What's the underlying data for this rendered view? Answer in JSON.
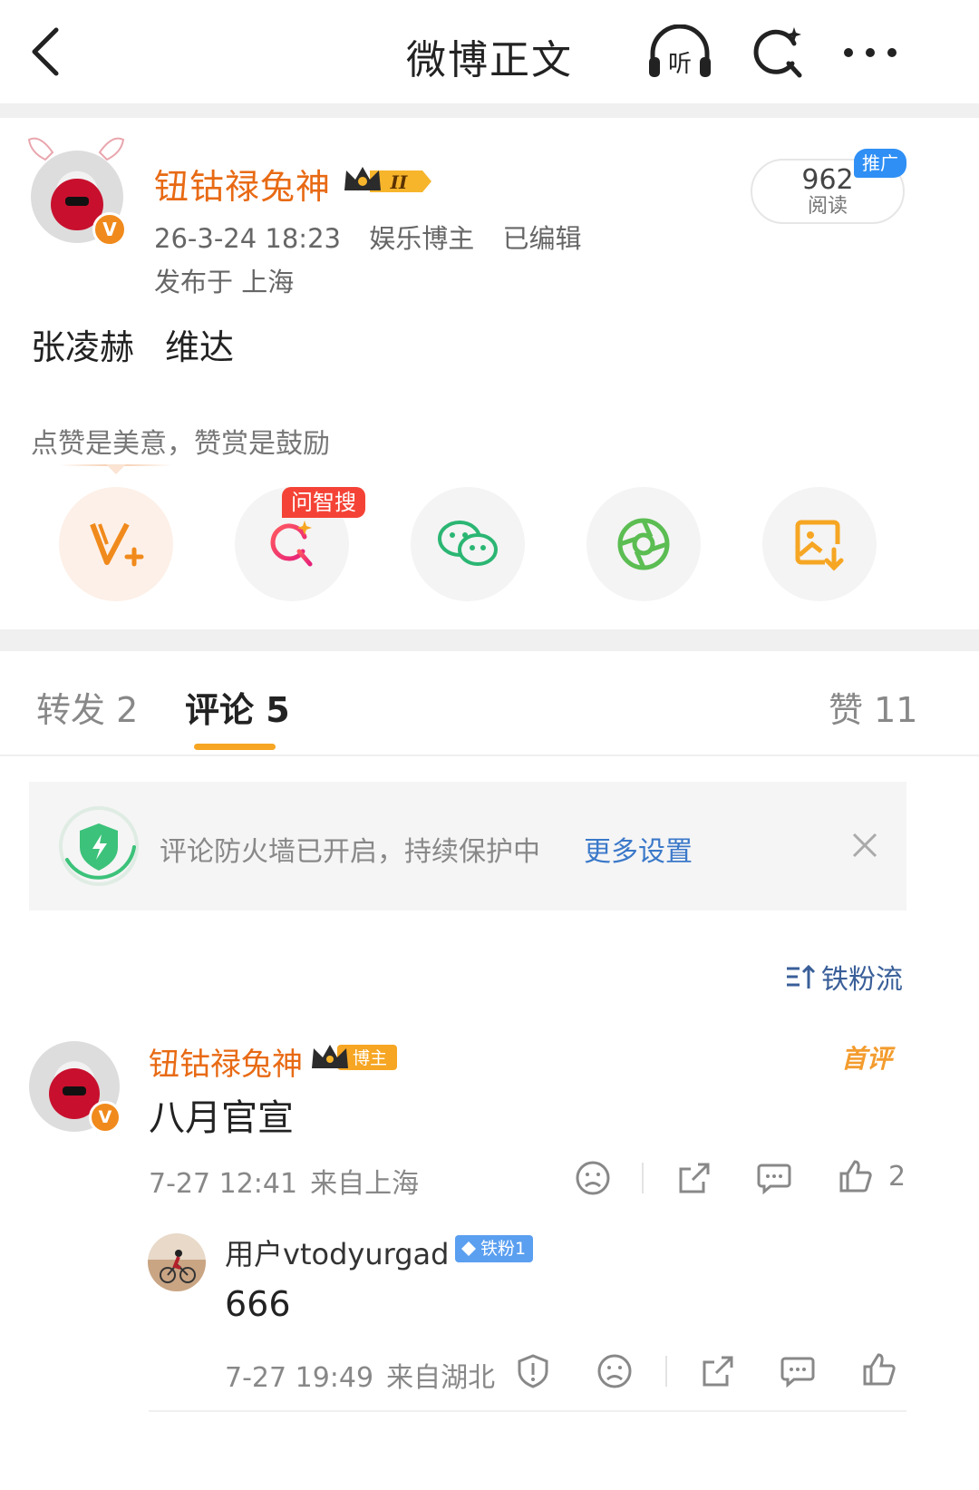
{
  "nav": {
    "title": "微博正文",
    "listen_label": "听"
  },
  "post": {
    "author": "钮钴禄兔神",
    "vip_level": "II",
    "date": "26-3-24 18:23",
    "role": "娱乐博主",
    "edited": "已编辑",
    "location": "发布于 上海",
    "reads": "962",
    "reads_label": "阅读",
    "promo_label": "推广",
    "text_parts": [
      "张凌赫",
      "维达"
    ],
    "reward_hint": "点赞是美意，赞赏是鼓励",
    "ai_search_tag": "问智搜"
  },
  "tabs": {
    "repost": "转发 2",
    "comments": "评论 5",
    "likes": "赞 11"
  },
  "notice": {
    "text": "评论防火墙已开启，持续保护中",
    "link": "更多设置"
  },
  "sort": {
    "label": "铁粉流"
  },
  "comment": {
    "author": "钮钴禄兔神",
    "tag": "博主",
    "first_tag": "首评",
    "text": "八月官宣",
    "date": "7-27 12:41",
    "location": "来自上海",
    "likes": "2"
  },
  "reply": {
    "author": "用户vtodyurgad",
    "fan_tag": "铁粉1",
    "text": "666",
    "date": "7-27 19:49",
    "location": "来自湖北"
  },
  "colors": {
    "accent_orange": "#e86a14",
    "tab_underline": "#f6a623",
    "link_blue": "#3a78c9",
    "promo_blue": "#2f8ff5",
    "ai_red": "#f44336"
  }
}
